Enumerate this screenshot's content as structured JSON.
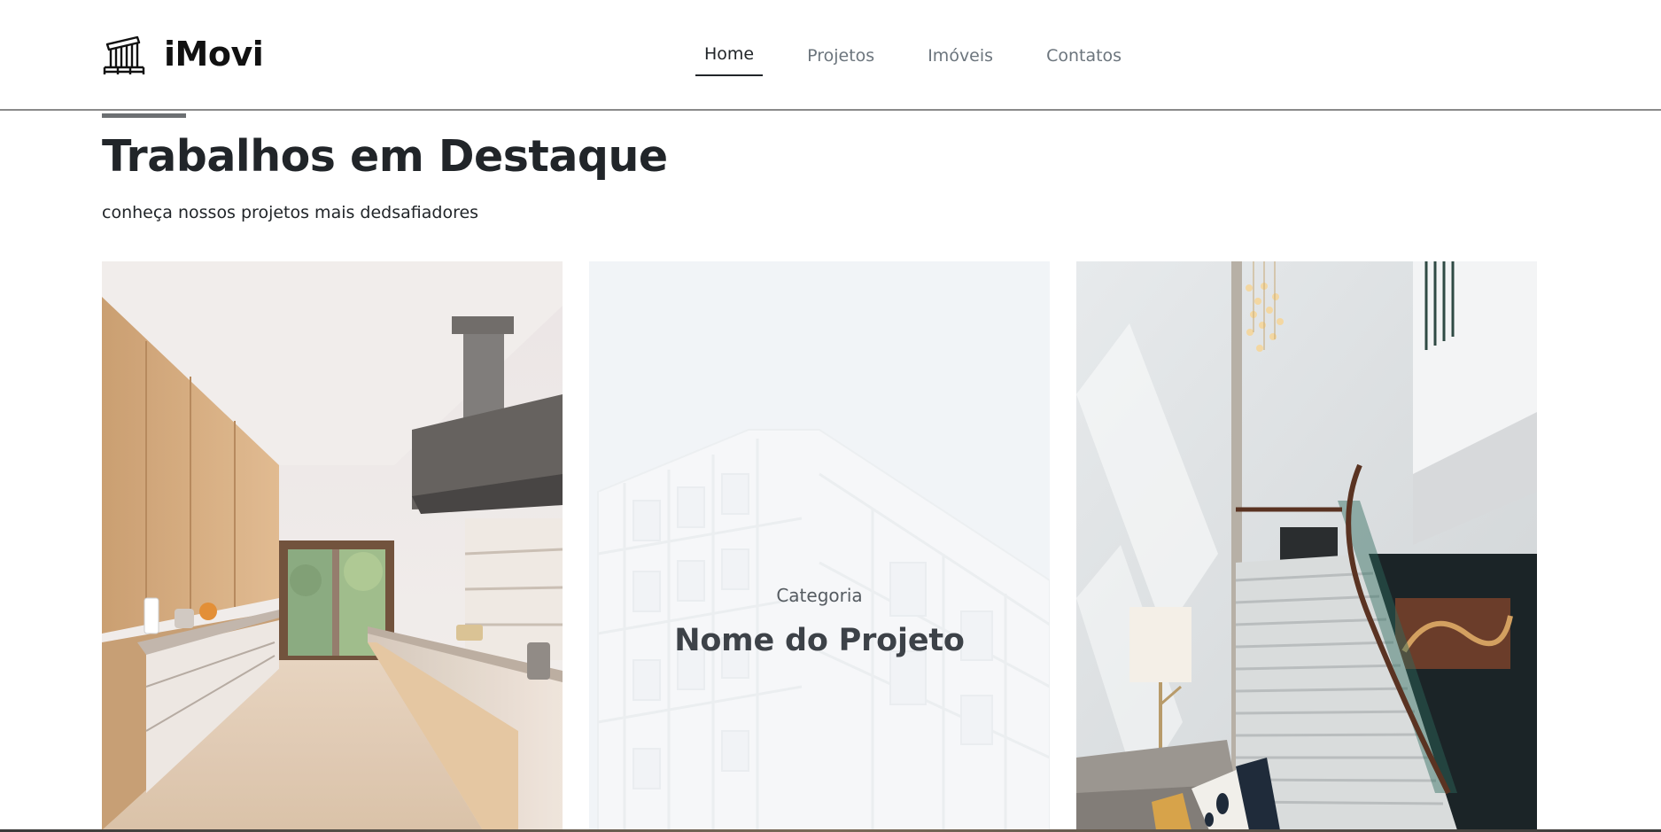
{
  "brand": {
    "name": "iMovi",
    "icon": "building-icon"
  },
  "nav": {
    "items": [
      {
        "label": "Home",
        "active": true
      },
      {
        "label": "Projetos",
        "active": false
      },
      {
        "label": "Imóveis",
        "active": false
      },
      {
        "label": "Contatos",
        "active": false
      }
    ]
  },
  "section": {
    "title": "Trabalhos em Destaque",
    "subtitle": "conheça nossos projetos mais dedsafiadores"
  },
  "cards": [
    {
      "image": "kitchen-photo"
    },
    {
      "image": "building-photo",
      "category": "Categoria",
      "project_name": "Nome do Projeto"
    },
    {
      "image": "staircase-photo"
    }
  ],
  "colors": {
    "accent_bar": "#6c6f72",
    "nav_active": "#212529",
    "nav_inactive": "#6c757d",
    "header_border": "#8a8a8a"
  }
}
